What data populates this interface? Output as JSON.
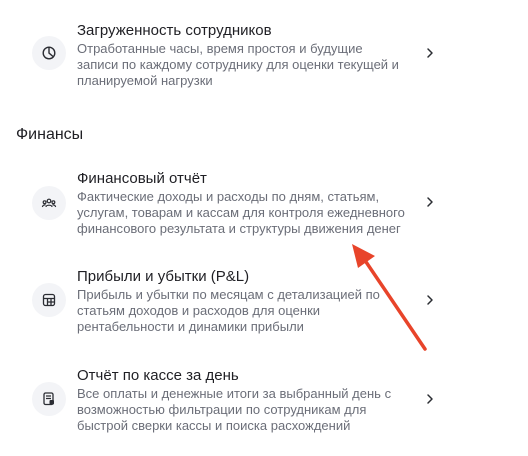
{
  "items_top": [
    {
      "title": "Загруженность сотрудников",
      "desc": "Отработанные часы, время простоя и будущие записи по каждому сотруднику для оценки текущей и планируемой нагрузки",
      "icon": "pie-chart-icon"
    }
  ],
  "section": {
    "title": "Финансы"
  },
  "finance_items": [
    {
      "title": "Финансовый отчёт",
      "desc": "Фактические доходы и расходы по дням, статьям, услугам, товарам и кассам для контроля ежедневного финансового результата и структуры движения денег",
      "icon": "users-icon"
    },
    {
      "title": "Прибыли и убытки (P&L)",
      "desc": "Прибыль и убытки по месяцам с детализацией по статьям доходов и расходов для оценки рентабельности и динамики прибыли",
      "icon": "table-icon"
    },
    {
      "title": "Отчёт по кассе за день",
      "desc": "Все оплаты и денежные итоги за выбранный день с возможностью фильтрации по сотрудникам для быстрой сверки кассы и поиска расхождений",
      "icon": "receipt-icon"
    }
  ],
  "annotation": {
    "color": "#e8442a"
  }
}
